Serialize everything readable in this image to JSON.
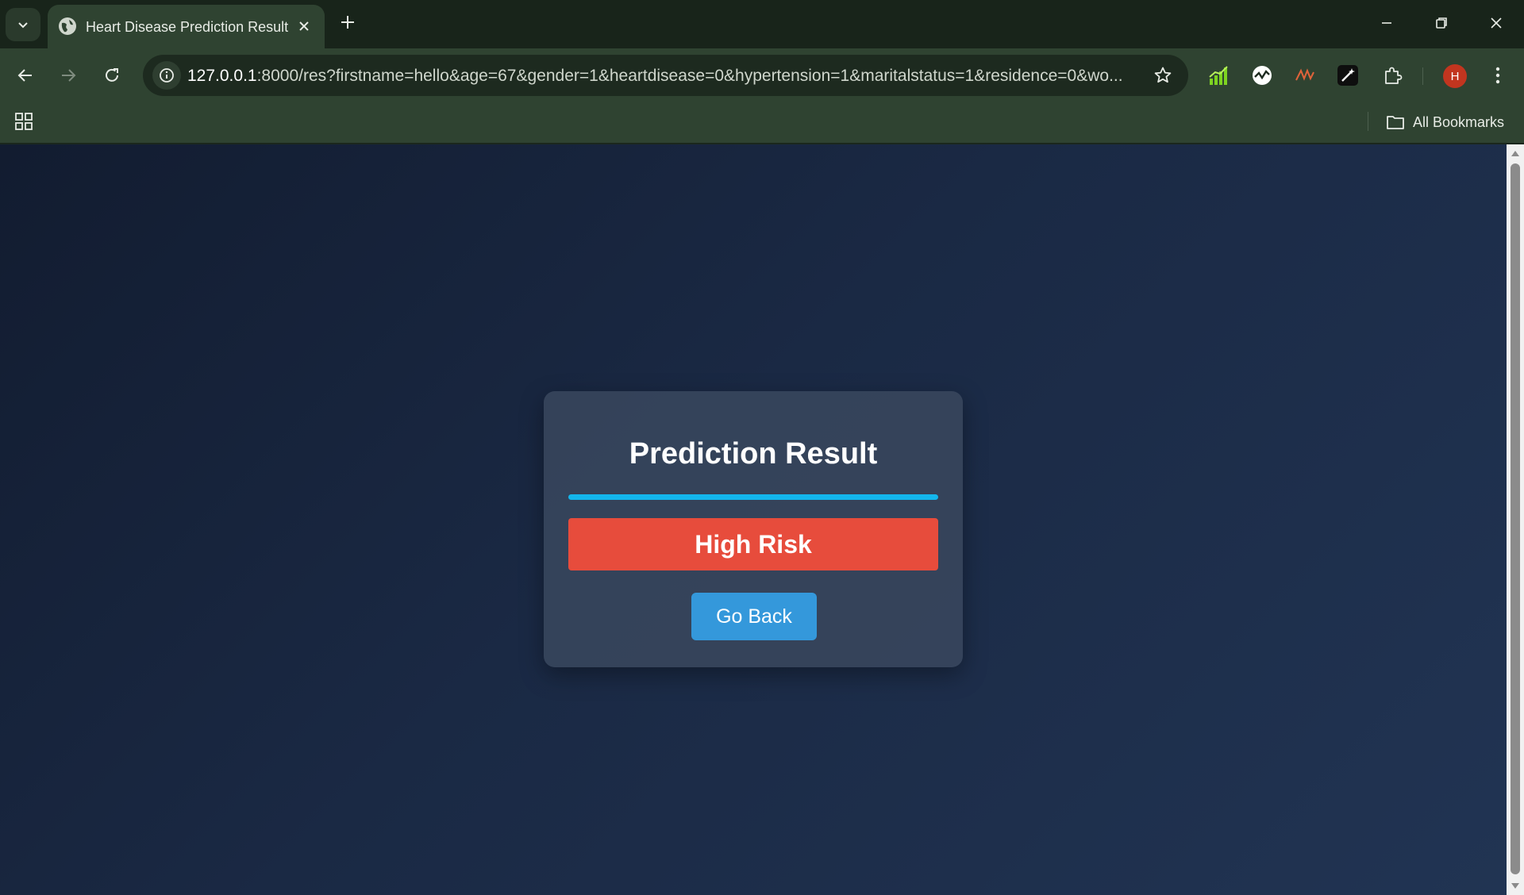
{
  "browser": {
    "tab": {
      "title": "Heart Disease Prediction Result"
    },
    "address_bar": {
      "host": "127.0.0.1",
      "path": ":8000/res?firstname=hello&age=67&gender=1&heartdisease=0&hypertension=1&maritalstatus=1&residence=0&wo..."
    },
    "profile_initial": "H",
    "bookmarks_bar": {
      "all_bookmarks_label": "All Bookmarks"
    }
  },
  "page": {
    "card": {
      "title": "Prediction Result",
      "result_label": "High Risk",
      "back_button_label": "Go Back"
    }
  },
  "colors": {
    "page_background": "#1a2944",
    "card_background": "#3a485e",
    "divider": "#13b6ec",
    "high_risk": "#e74c3c",
    "back_button": "#3498db"
  }
}
